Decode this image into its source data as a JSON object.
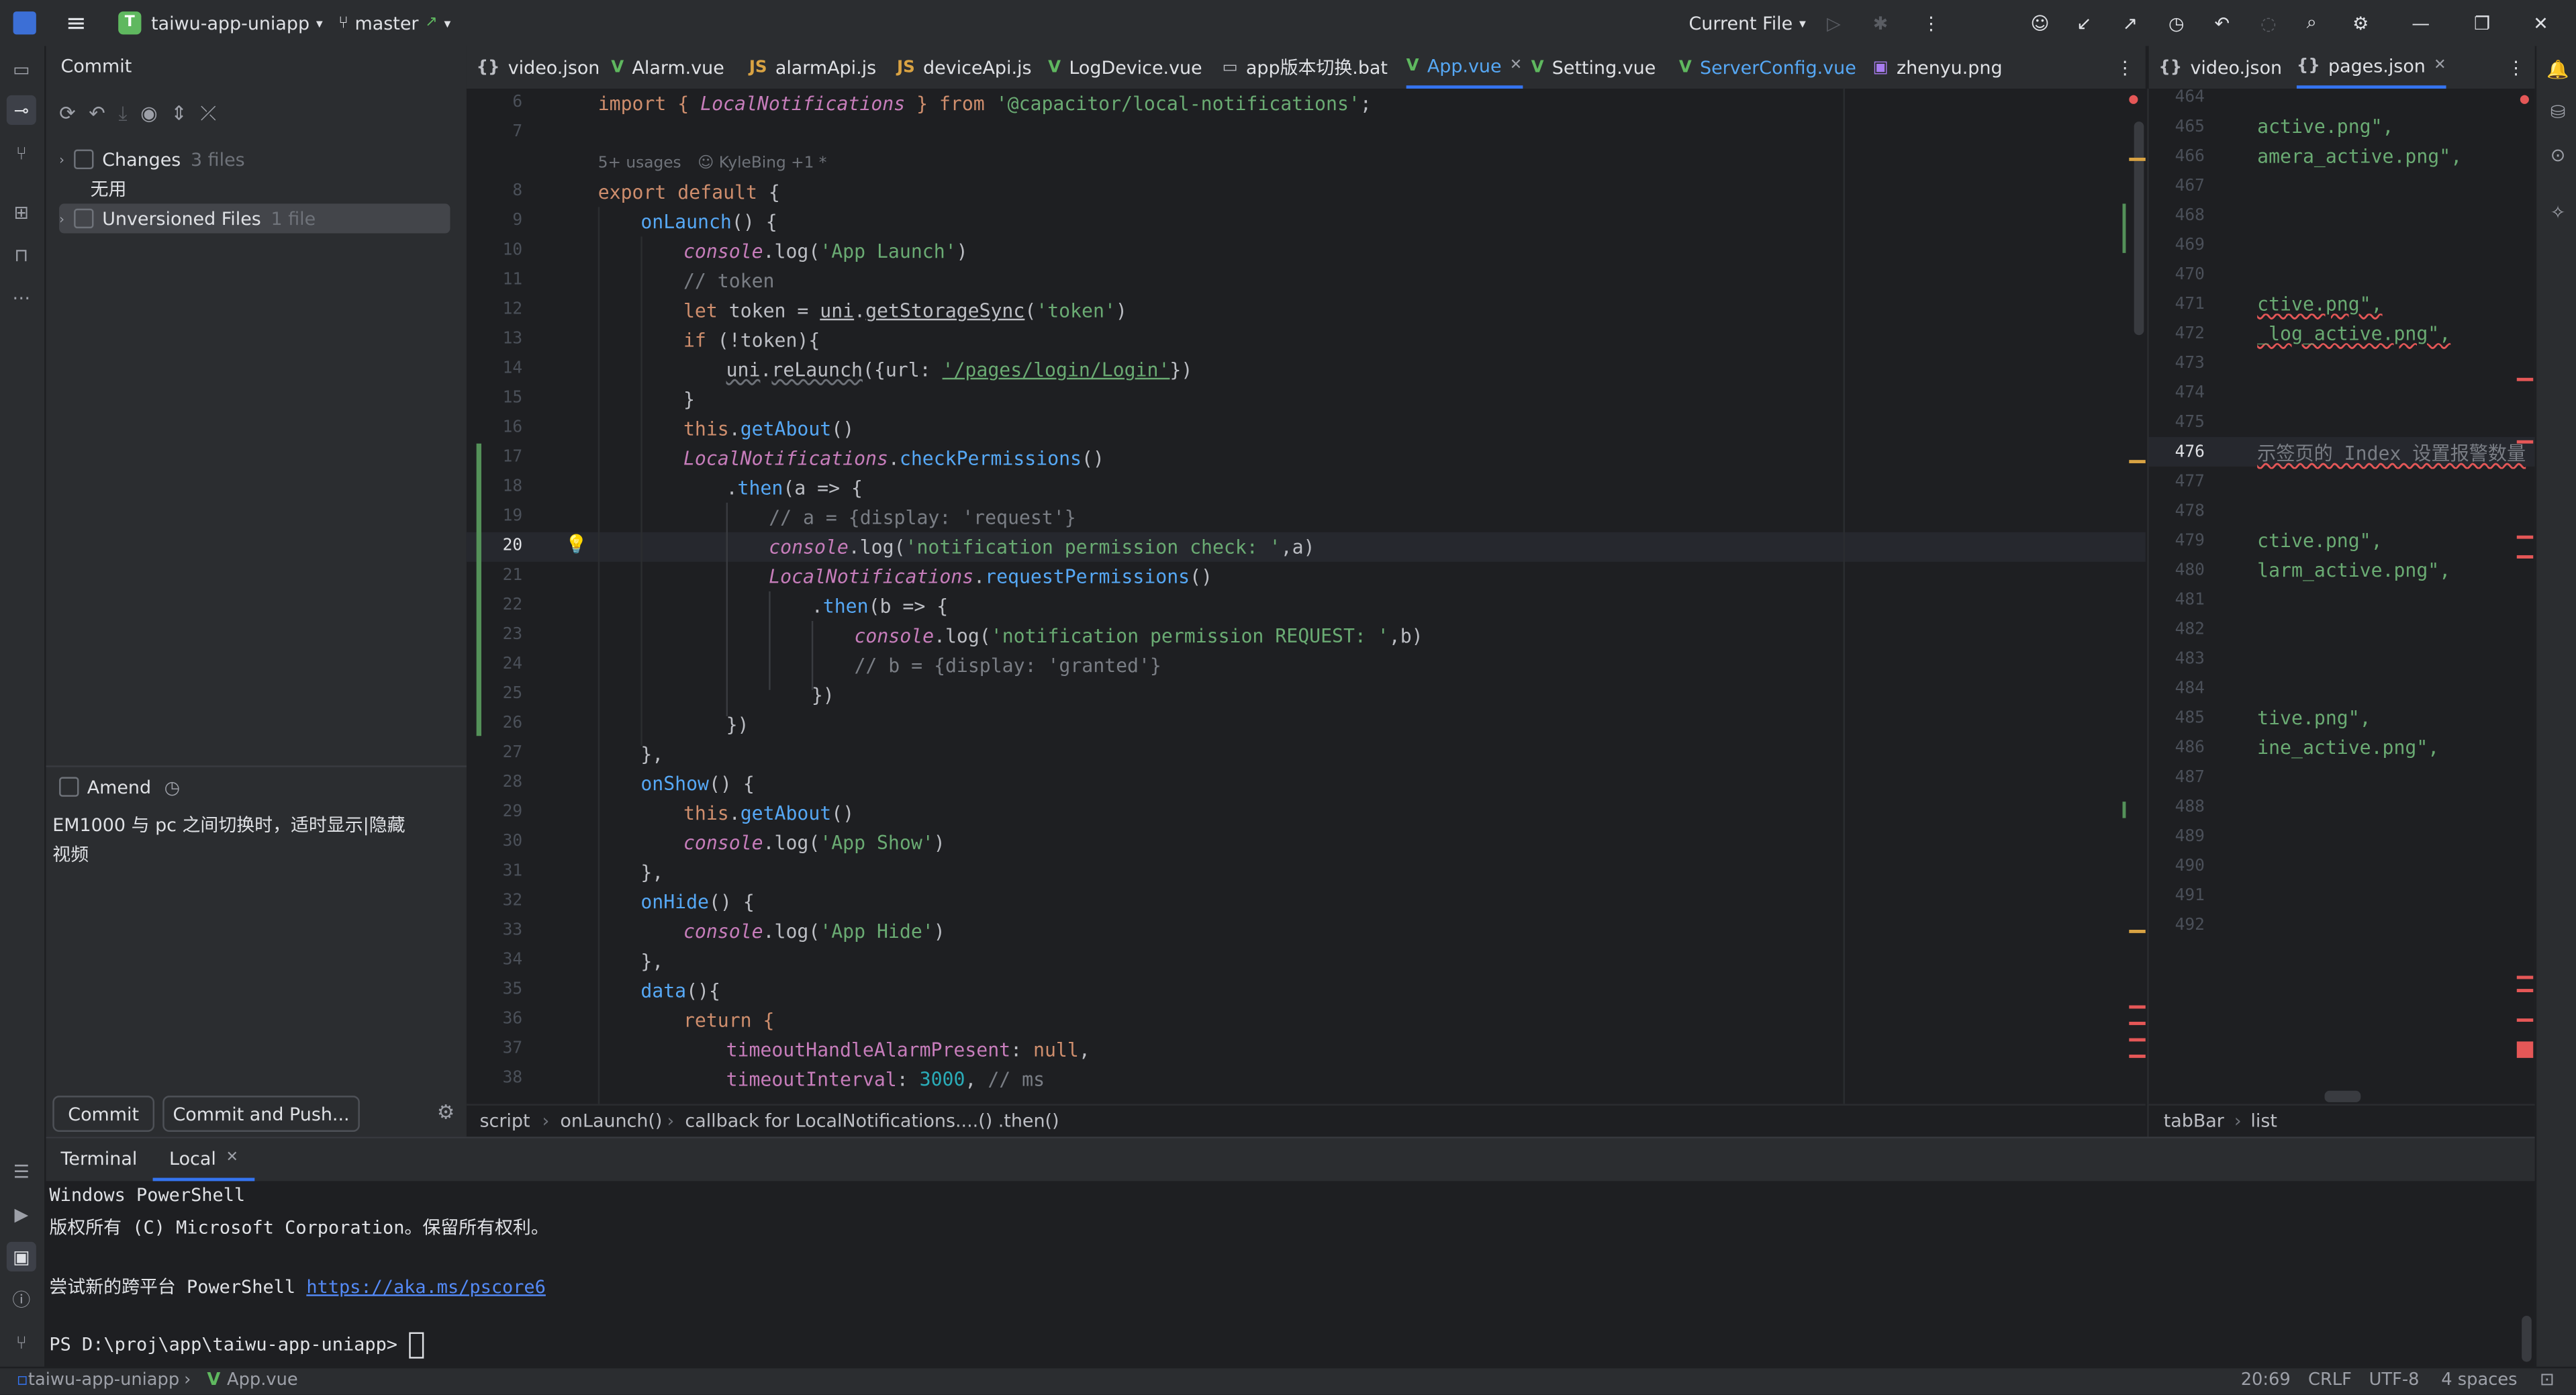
{
  "titlebar": {
    "project_badge": "T",
    "project_name": "taiwu-app-uniapp",
    "branch": "master",
    "run_config": "Current File"
  },
  "commit_panel": {
    "title": "Commit",
    "changes_label": "Changes",
    "changes_count": "3 files",
    "changelist_wuyong": "无用",
    "unversioned_label": "Unversioned Files",
    "unversioned_count": "1 file",
    "amend_label": "Amend",
    "message_line1": "EM1000 与 pc 之间切换时，适时显示|隐藏",
    "message_line2": "视频",
    "commit_button": "Commit",
    "commit_push_button": "Commit and Push..."
  },
  "tabs": [
    {
      "label": "video.json",
      "icon": "{}",
      "color": "#bcbec4"
    },
    {
      "label": "Alarm.vue",
      "icon": "V",
      "color": "#5fb85f"
    },
    {
      "label": "alarmApi.js",
      "icon": "JS",
      "color": "#d9a343"
    },
    {
      "label": "deviceApi.js",
      "icon": "JS",
      "color": "#d9a343"
    },
    {
      "label": "LogDevice.vue",
      "icon": "V",
      "color": "#5fb85f"
    },
    {
      "label": "app版本切换.bat",
      "icon": "▭",
      "color": "#bcbec4"
    },
    {
      "label": "App.vue",
      "icon": "V",
      "color": "#5fb85f",
      "active": true
    },
    {
      "label": "Setting.vue",
      "icon": "V",
      "color": "#5fb85f"
    },
    {
      "label": "ServerConfig.vue",
      "icon": "V",
      "color": "#5fb85f"
    },
    {
      "label": "zhenyu.png",
      "icon": "▣",
      "color": "#a87cf0"
    }
  ],
  "tabs_right": [
    {
      "label": "video.json",
      "icon": "{}"
    },
    {
      "label": "pages.json",
      "icon": "{}",
      "active": true
    }
  ],
  "editor": {
    "usages_hint": "5+ usages",
    "author_hint": "KyleBing +1 *",
    "line_numbers": [
      "6",
      "7",
      "",
      "8",
      "9",
      "10",
      "11",
      "12",
      "13",
      "14",
      "15",
      "16",
      "17",
      "18",
      "19",
      "20",
      "21",
      "22",
      "23",
      "24",
      "25",
      "26",
      "27",
      "28",
      "29",
      "30",
      "31",
      "32",
      "33",
      "34",
      "35",
      "36",
      "37",
      "38"
    ],
    "lines": {
      "l6a": "import { ",
      "l6b": "LocalNotifications",
      "l6c": " } from ",
      "l6d": "'@capacitor/local-notifications'",
      "l6e": ";",
      "l8a": "export default ",
      "l8b": "{",
      "l9": "onLaunch",
      "l9b": "() {",
      "l10a": "console",
      "l10b": ".log(",
      "l10c": "'App Launch'",
      "l10d": ")",
      "l11": "// token",
      "l12a": "let ",
      "l12b": "token = ",
      "l12c": "uni",
      "l12d": ".",
      "l12e": "getStorageSync",
      "l12f": "(",
      "l12g": "'token'",
      "l12h": ")",
      "l13a": "if ",
      "l13b": "(!token){",
      "l14a": "uni",
      "l14b": ".",
      "l14c": "reLaunch",
      "l14d": "({url: ",
      "l14e": "'/pages/login/Login'",
      "l14f": "})",
      "l15": "}",
      "l16a": "this",
      "l16b": ".",
      "l16c": "getAbout",
      "l16d": "()",
      "l17a": "LocalNotifications",
      "l17b": ".",
      "l17c": "checkPermissions",
      "l17d": "()",
      "l18a": ".",
      "l18b": "then",
      "l18c": "(a => {",
      "l19": "// a = {display: 'request'}",
      "l20a": "console",
      "l20b": ".log(",
      "l20c": "'notification permission check: '",
      "l20d": ",a)",
      "l21a": "LocalNotifications",
      "l21b": ".",
      "l21c": "requestPermissions",
      "l21d": "()",
      "l22a": ".",
      "l22b": "then",
      "l22c": "(b => {",
      "l23a": "console",
      "l23b": ".log(",
      "l23c": "'notification permission REQUEST: '",
      "l23d": ",b)",
      "l24": "// b = {display: 'granted'}",
      "l25": "})",
      "l26": "})",
      "l27": "},",
      "l28a": "onShow",
      "l28b": "() {",
      "l29a": "this",
      "l29b": ".",
      "l29c": "getAbout",
      "l29d": "()",
      "l30a": "console",
      "l30b": ".log(",
      "l30c": "'App Show'",
      "l30d": ")",
      "l31": "},",
      "l32a": "onHide",
      "l32b": "() {",
      "l33a": "console",
      "l33b": ".log(",
      "l33c": "'App Hide'",
      "l33d": ")",
      "l34": "},",
      "l35a": "data",
      "l35b": "(){",
      "l36": "return {",
      "l37a": "timeoutHandleAlarmPresent",
      "l37b": ": ",
      "l37c": "null",
      "l37d": ",",
      "l38a": "timeoutInterval",
      "l38b": ": ",
      "l38c": "3000",
      "l38d": ", ",
      "l38e": "// ms"
    }
  },
  "editor_right": {
    "line_numbers": [
      "464",
      "465",
      "466",
      "467",
      "468",
      "469",
      "470",
      "471",
      "472",
      "473",
      "474",
      "475",
      "476",
      "477",
      "478",
      "479",
      "480",
      "481",
      "482",
      "483",
      "484",
      "485",
      "486",
      "487",
      "488",
      "489",
      "490",
      "491",
      "492"
    ],
    "snippets": {
      "465": "active.png\",",
      "466": "amera_active.png\",",
      "471": "ctive.png\",",
      "472": "_log_active.png\",",
      "476": "示签页的 Index 设置报警数量",
      "479": "ctive.png\",",
      "480": "larm_active.png\",",
      "485": "tive.png\",",
      "486": "ine_active.png\","
    }
  },
  "breadcrumb": {
    "items": [
      "script",
      "onLaunch()",
      "callback for LocalNotifications....() .then()"
    ],
    "right_items": [
      "tabBar",
      "list"
    ]
  },
  "terminal": {
    "tab_title": "Terminal",
    "tab_local": "Local",
    "line1": "Windows PowerShell",
    "line2": "版权所有 (C) Microsoft Corporation。保留所有权利。",
    "line3_prefix": "尝试新的跨平台 PowerShell ",
    "line3_link": "https://aka.ms/pscore6",
    "prompt": "PS D:\\proj\\app\\taiwu-app-uniapp>"
  },
  "statusbar": {
    "project": "taiwu-app-uniapp",
    "file": "App.vue",
    "position": "20:69",
    "line_ending": "CRLF",
    "encoding": "UTF-8",
    "indent": "4 spaces"
  }
}
